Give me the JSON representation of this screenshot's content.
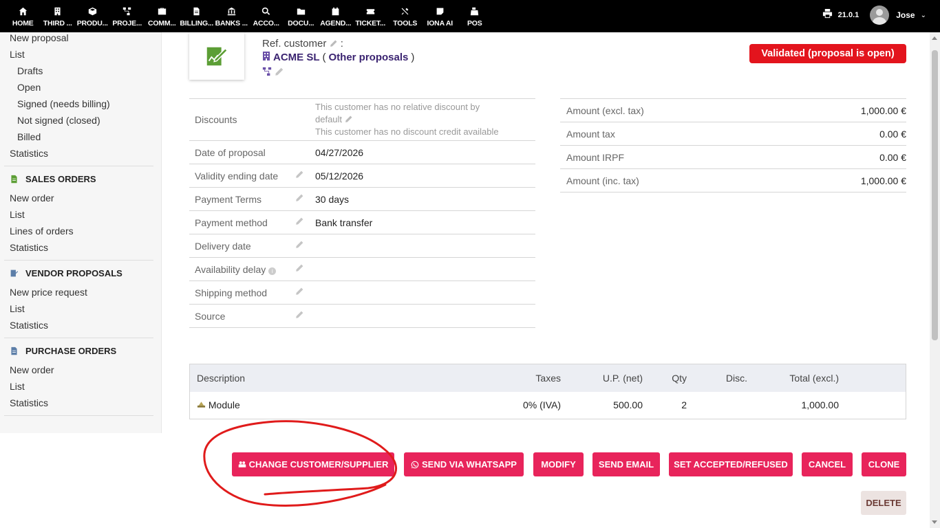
{
  "topmenu": [
    {
      "label": "HOME",
      "icon": "home-icon"
    },
    {
      "label": "THIRD ...",
      "icon": "building-icon"
    },
    {
      "label": "PRODU...",
      "icon": "cube-icon"
    },
    {
      "label": "PROJE...",
      "icon": "sitemap-icon"
    },
    {
      "label": "COMM...",
      "icon": "briefcase-icon"
    },
    {
      "label": "BILLING...",
      "icon": "invoice-icon"
    },
    {
      "label": "BANKS ...",
      "icon": "bank-icon"
    },
    {
      "label": "ACCO...",
      "icon": "search-dollar-icon"
    },
    {
      "label": "DOCU...",
      "icon": "folder-icon"
    },
    {
      "label": "AGEND...",
      "icon": "calendar-icon"
    },
    {
      "label": "TICKET...",
      "icon": "ticket-icon"
    },
    {
      "label": "TOOLS",
      "icon": "tools-icon"
    },
    {
      "label": "IONA AI",
      "icon": "note-icon"
    },
    {
      "label": "POS",
      "icon": "cash-register-icon"
    }
  ],
  "header": {
    "version": "21.0.1",
    "username": "Jose",
    "caret": "⌄"
  },
  "sidebar": {
    "proposals": {
      "new": "New proposal",
      "list": "List",
      "drafts": "Drafts",
      "open": "Open",
      "signed": "Signed (needs billing)",
      "not_signed": "Not signed (closed)",
      "billed": "Billed",
      "stats": "Statistics"
    },
    "sales_orders": {
      "title": "SALES ORDERS",
      "new": "New order",
      "list": "List",
      "lines": "Lines of orders",
      "stats": "Statistics"
    },
    "vendor_proposals": {
      "title": "VENDOR PROPOSALS",
      "new": "New price request",
      "list": "List",
      "stats": "Statistics"
    },
    "purchase_orders": {
      "title": "PURCHASE ORDERS",
      "new": "New order",
      "list": "List",
      "stats": "Statistics"
    }
  },
  "proposal": {
    "ref_customer_label": "Ref. customer",
    "ref_customer_suffix": " :",
    "customer_name": "ACME SL",
    "other_proposals": "Other proposals",
    "paren_open": "(",
    "paren_close": ")",
    "status": "Validated (proposal is open)",
    "status_color": "#e3141d"
  },
  "info": {
    "discounts_label": "Discounts",
    "discount_line1": "This customer has no relative discount by",
    "discount_line2": "default",
    "discount_line3": "This customer has no discount credit available",
    "date_label": "Date of proposal",
    "date_value": "04/27/2026",
    "validity_label": "Validity ending date",
    "validity_value": "05/12/2026",
    "payment_terms_label": "Payment Terms",
    "payment_terms_value": "30 days",
    "payment_method_label": "Payment method",
    "payment_method_value": "Bank transfer",
    "delivery_label": "Delivery date",
    "availability_label": "Availability delay",
    "shipping_label": "Shipping method",
    "source_label": "Source"
  },
  "amounts": [
    {
      "label": "Amount (excl. tax)",
      "value": "1,000.00 €"
    },
    {
      "label": "Amount tax",
      "value": "0.00 €"
    },
    {
      "label": "Amount IRPF",
      "value": "0.00 €"
    },
    {
      "label": "Amount (inc. tax)",
      "value": "1,000.00 €"
    }
  ],
  "lines": {
    "headers": {
      "description": "Description",
      "taxes": "Taxes",
      "up": "U.P. (net)",
      "qty": "Qty",
      "disc": "Disc.",
      "total": "Total (excl.)"
    },
    "rows": [
      {
        "description": "Module",
        "taxes": "0% (IVA)",
        "up": "500.00",
        "qty": "2",
        "disc": "",
        "total": "1,000.00"
      }
    ]
  },
  "actions": {
    "change_customer": "CHANGE CUSTOMER/SUPPLIER",
    "whatsapp": "SEND VIA WHATSAPP",
    "modify": "MODIFY",
    "send_email": "SEND EMAIL",
    "set_accepted": "SET ACCEPTED/REFUSED",
    "cancel": "CANCEL",
    "clone": "CLONE",
    "delete": "DELETE",
    "accent_color": "#e8245b"
  }
}
